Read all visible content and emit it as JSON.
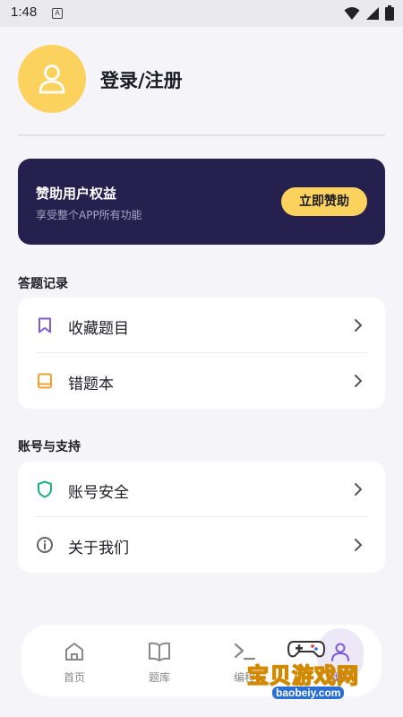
{
  "status_bar": {
    "time": "1:48",
    "a_badge": "A"
  },
  "profile": {
    "login_label": "登录/注册"
  },
  "sponsor": {
    "title": "赞助用户权益",
    "subtitle": "享受整个APP所有功能",
    "button_label": "立即赞助"
  },
  "sections": {
    "records": {
      "title": "答题记录",
      "items": [
        {
          "label": "收藏题目",
          "icon": "bookmark-icon",
          "color": "#7b5cd6"
        },
        {
          "label": "错题本",
          "icon": "book-icon",
          "color": "#f0a030"
        }
      ]
    },
    "account": {
      "title": "账号与支持",
      "items": [
        {
          "label": "账号安全",
          "icon": "shield-icon",
          "color": "#22b07d"
        },
        {
          "label": "关于我们",
          "icon": "info-icon",
          "color": "#666666"
        }
      ]
    }
  },
  "bottom_nav": {
    "items": [
      {
        "label": "首页",
        "icon": "home-icon"
      },
      {
        "label": "题库",
        "icon": "open-book-icon"
      },
      {
        "label": "编程",
        "icon": "terminal-icon"
      },
      {
        "label": "我的",
        "icon": "profile-icon",
        "active": true
      }
    ]
  },
  "watermark": {
    "text": "宝贝游戏网",
    "url": "baobeiy.com"
  },
  "colors": {
    "accent_yellow": "#fcd25e",
    "sponsor_bg": "#26204f",
    "background": "#f5f5f9"
  }
}
